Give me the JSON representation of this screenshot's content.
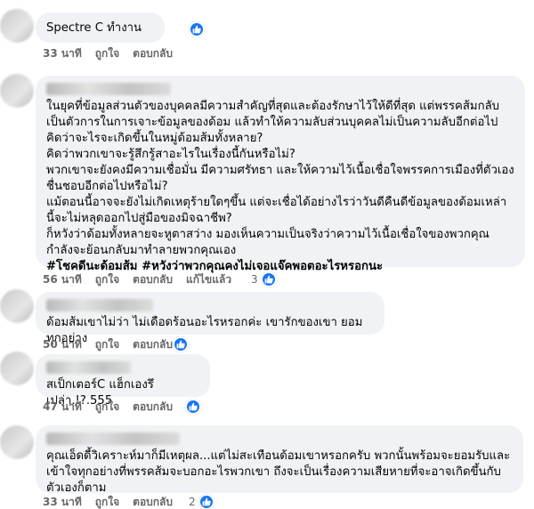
{
  "actions": {
    "like": "ถูกใจ",
    "reply": "ตอบกลับ",
    "edited": "แก้ไขแล้ว"
  },
  "comments": [
    {
      "text": "Spectre C ทำงาน",
      "time": "33 นาที",
      "reactions": "",
      "has_reaction": true
    },
    {
      "paragraphs": [
        "ในยุคที่ข้อมูลส่วนตัวของบุคคลมีความสำคัญที่สุดและต้องรักษาไว้ให้ดีที่สุด แต่พรรคส้มกลับเป็นตัวการในการเจาะข้อมูลของด้อม แล้วทำให้ความลับส่วนบุคคลไม่เป็นความลับอีกต่อไป",
        "คิดว่าจะไรจะเกิดขึ้นในหมู่ด้อมส้มทั้งหลาย?",
        "คิดว่าพวกเขาจะรู้สึกรู้สาอะไรในเรื่องนี้กันหรือไม่?",
        "พวกเขาจะยังคงมีความเชื่อมั่น มีความศรัทธา และให้ความไว้เนื้อเชื่อใจพรรคการเมืองที่ตัวเองชื่นชอบอีกต่อไปหรือไม่?",
        "แม้ตอนนี้อาจจะยังไม่เกิดเหตุร้ายใดๆขึ้น แต่จะเชื่อได้อย่างไรว่าวันดีคืนดีข้อมูลของด้อมเหล่านี้จะไม่หลุดออกไปสู่มือของมิจฉาชีพ?",
        "ก็หวังว่าด้อมทั้งหลายจะหูตาสว่าง มองเห็นความเป็นจริงว่าความไว้เนื้อเชื่อใจของพวกคุณ กำลังจะย้อนกลับมาทำลายพวกคุณเอง"
      ],
      "hashtags": "#โชคดีนะด้อมส้ม #หวังว่าพวกคุณคงไม่เจอแจ๊คพอตอะไรหรอกนะ",
      "time": "56 นาที",
      "reactions": "3",
      "edited": true
    },
    {
      "text": "ด้อมส้มเขาไม่ว่า ไม่เดือดร้อนอะไรหรอกค่ะ เขารักของเขา ยอมทุกอย่าง",
      "time": "50 นาที",
      "reactions": "",
      "has_reaction": true
    },
    {
      "text": "สเป็กเตอร์C แฮ็กเองรึเปล่า.!?.555",
      "time": "47 นาที",
      "reactions": "",
      "has_reaction": true
    },
    {
      "text": "คุณเอ็ดดี้วิเคราะห์มาก็มีเหตุผล...แต่ไม่สะเทือนด้อมเขาหรอกครับ พวกนั้นพร้อมจะยอมรับและเข้าใจทุกอย่างที่พรรคส้มจะบอกอะไรพวกเขา ถึงจะเป็นเรื่องความเสียหายที่จะอาจเกิดขึ้นกับตัวเองก็ตาม",
      "time": "33 นาที",
      "reactions": "2",
      "has_reaction": true
    }
  ],
  "colors": {
    "bubble": "#f0f2f5",
    "meta": "#65676b",
    "like": "#1877f2"
  }
}
